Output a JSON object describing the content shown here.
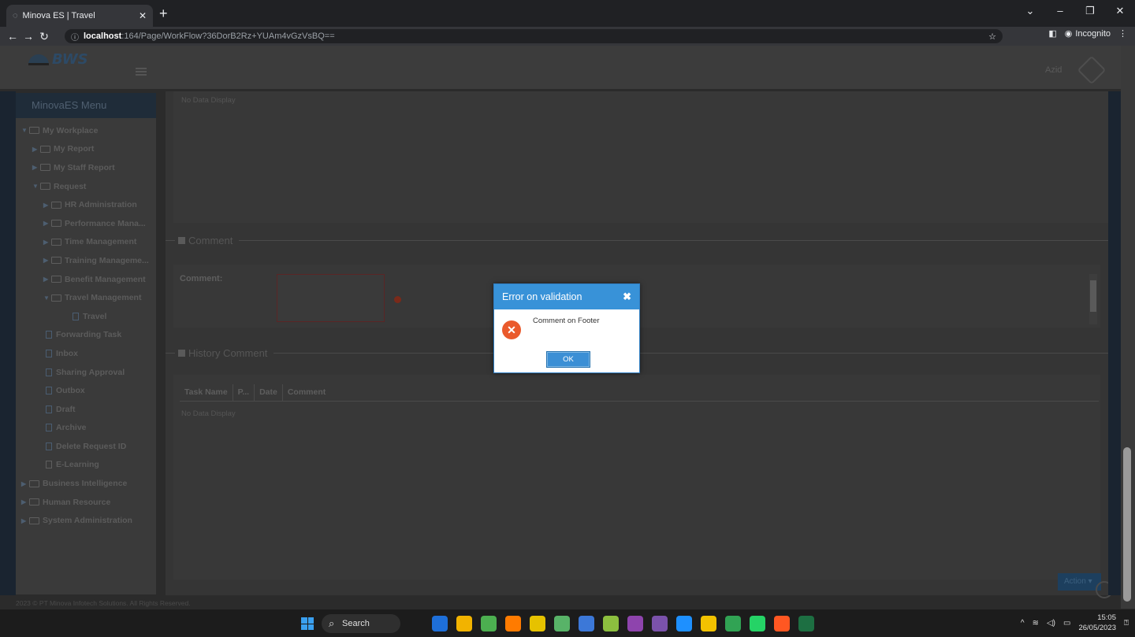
{
  "browser": {
    "tab_title": "Minova ES | Travel",
    "url_host": "localhost",
    "url_path": ":164/Page/WorkFlow?36DorB2Rz+YUAm4vGzVsBQ==",
    "incognito_label": "Incognito"
  },
  "header": {
    "logo_text": "BWS",
    "user_name": "Azid"
  },
  "sidebar": {
    "title": "MinovaES Menu",
    "items": [
      {
        "label": "My Workplace",
        "level": "lvl0",
        "type": "folder-open"
      },
      {
        "label": "My Report",
        "level": "lvl1",
        "type": "folder"
      },
      {
        "label": "My Staff Report",
        "level": "lvl1",
        "type": "folder"
      },
      {
        "label": "Request",
        "level": "lvl1",
        "type": "folder-open"
      },
      {
        "label": "HR Administration",
        "level": "lvl2",
        "type": "folder"
      },
      {
        "label": "Performance Mana...",
        "level": "lvl2",
        "type": "folder"
      },
      {
        "label": "Time Management",
        "level": "lvl2",
        "type": "folder"
      },
      {
        "label": "Training Manageme...",
        "level": "lvl2",
        "type": "folder"
      },
      {
        "label": "Benefit Management",
        "level": "lvl2",
        "type": "folder"
      },
      {
        "label": "Travel Management",
        "level": "lvl2",
        "type": "folder-open"
      },
      {
        "label": "Travel",
        "level": "lvl3",
        "type": "doc"
      },
      {
        "label": "Forwarding Task",
        "level": "lvl2d",
        "type": "doc"
      },
      {
        "label": "Inbox",
        "level": "lvl2d",
        "type": "doc"
      },
      {
        "label": "Sharing Approval",
        "level": "lvl2d",
        "type": "doc"
      },
      {
        "label": "Outbox",
        "level": "lvl2d",
        "type": "doc"
      },
      {
        "label": "Draft",
        "level": "lvl2d",
        "type": "doc"
      },
      {
        "label": "Archive",
        "level": "lvl2d",
        "type": "doc"
      },
      {
        "label": "Delete Request ID",
        "level": "lvl2d",
        "type": "doc"
      },
      {
        "label": "E-Learning",
        "level": "lvl2d",
        "type": "doc-plain"
      },
      {
        "label": "Business Intelligence",
        "level": "lvl0",
        "type": "folder"
      },
      {
        "label": "Human Resource",
        "level": "lvl0",
        "type": "folder"
      },
      {
        "label": "System Administration",
        "level": "lvl0",
        "type": "folder"
      }
    ],
    "footer": "2023 © PT Minova Infotech Solutions. All Rights Reserved."
  },
  "main": {
    "top_nodata": "No Data Display",
    "comment_section": "Comment",
    "comment_label": "Comment:",
    "history_section": "History Comment",
    "history_columns": [
      "Task Name",
      "P...",
      "Date",
      "Comment"
    ],
    "history_nodata": "No Data Display",
    "action_label": "Action"
  },
  "modal": {
    "title": "Error on validation",
    "message": "Comment on Footer",
    "ok_label": "OK"
  },
  "taskbar": {
    "search_label": "Search",
    "time": "15:05",
    "date": "26/05/2023",
    "apps": [
      "#1e6fd9",
      "#f2b300",
      "#4caf50",
      "#ff7b00",
      "#e6c200",
      "#58b368",
      "#3c78d8",
      "#8cbf3f",
      "#8e44ad",
      "#7b52ab",
      "#1e90ff",
      "#f2c200",
      "#31a354",
      "#25d366",
      "#ff5722",
      "#1d6f42"
    ]
  },
  "colors": {
    "modal_header": "#3892d8",
    "error_icon": "#ea5a2c"
  }
}
